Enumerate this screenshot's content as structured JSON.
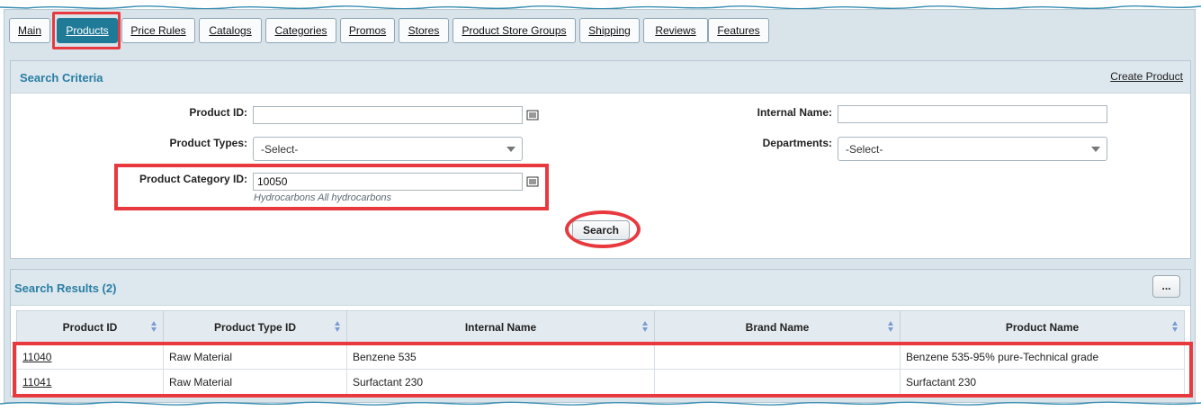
{
  "tabs": [
    {
      "label": "Main",
      "active": false
    },
    {
      "label": "Products",
      "active": true
    },
    {
      "label": "Price Rules",
      "active": false
    },
    {
      "label": "Catalogs",
      "active": false
    },
    {
      "label": "Categories",
      "active": false
    },
    {
      "label": "Promos",
      "active": false
    },
    {
      "label": "Stores",
      "active": false
    },
    {
      "label": "Product Store Groups",
      "active": false
    },
    {
      "label": "Shipping",
      "active": false
    },
    {
      "label": "Reviews",
      "active": false
    },
    {
      "label": "Features",
      "active": false
    }
  ],
  "search_criteria": {
    "title": "Search Criteria",
    "create_link": "Create Product",
    "product_id_label": "Product ID:",
    "product_id_value": "",
    "internal_name_label": "Internal Name:",
    "internal_name_value": "",
    "product_types_label": "Product Types:",
    "product_types_value": "-Select-",
    "departments_label": "Departments:",
    "departments_value": "-Select-",
    "category_label": "Product Category ID:",
    "category_value": "10050",
    "category_hint": "Hydrocarbons All hydrocarbons",
    "search_button": "Search"
  },
  "results": {
    "title": "Search Results (2)",
    "more_button": "...",
    "columns": [
      "Product ID",
      "Product Type ID",
      "Internal Name",
      "Brand Name",
      "Product Name"
    ],
    "rows": [
      {
        "product_id": "11040",
        "type": "Raw Material",
        "internal_name": "Benzene 535",
        "brand": "",
        "product_name": "Benzene 535-95% pure-Technical grade"
      },
      {
        "product_id": "11041",
        "type": "Raw Material",
        "internal_name": "Surfactant 230",
        "brand": "",
        "product_name": "Surfactant 230"
      }
    ]
  },
  "colors": {
    "accent": "#1f7a98",
    "highlight": "#e8393f",
    "title": "#2a7ea3"
  },
  "icons": [
    "lookup-icon",
    "sort-icon",
    "chevron-down-icon"
  ]
}
